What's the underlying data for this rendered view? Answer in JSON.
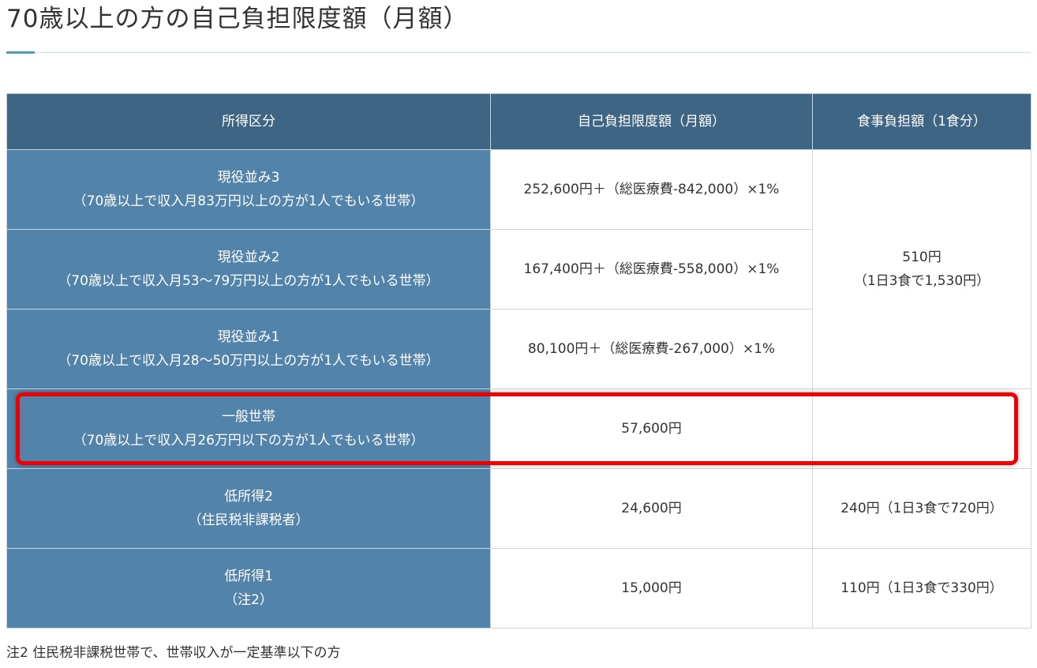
{
  "title": "70歳以上の方の自己負担限度額（月額）",
  "table": {
    "headers": [
      "所得区分",
      "自己負担限度額（月額）",
      "食事負担額（1食分）"
    ],
    "rows": [
      {
        "category": [
          "現役並み3",
          "（70歳以上で収入月83万円以上の方が1人でもいる世帯）"
        ],
        "limit": "252,600円＋（総医療費-842,000）×1%"
      },
      {
        "category": [
          "現役並み2",
          "（70歳以上で収入月53～79万円以上の方が1人でもいる世帯）"
        ],
        "limit": "167,400円＋（総医療費-558,000）×1%"
      },
      {
        "category": [
          "現役並み1",
          "（70歳以上で収入月28～50万円以上の方が1人でもいる世帯）"
        ],
        "limit": "80,100円＋（総医療費-267,000）×1%"
      },
      {
        "category": [
          "一般世帯",
          "（70歳以上で収入月26万円以下の方が1人でもいる世帯）"
        ],
        "limit": "57,600円"
      },
      {
        "category": [
          "低所得2",
          "（住民税非課税者）"
        ],
        "limit": "24,600円",
        "meal": "240円（1日3食で720円）"
      },
      {
        "category": [
          "低所得1",
          "（注2）"
        ],
        "limit": "15,000円",
        "meal": "110円（1日3食で330円）"
      }
    ],
    "merged_meal": [
      "510円",
      "（1日3食で1,530円）"
    ]
  },
  "highlight_color": "#ee0000",
  "footnote": "注2 住民税非課税世帯で、世帯収入が一定基準以下の方"
}
